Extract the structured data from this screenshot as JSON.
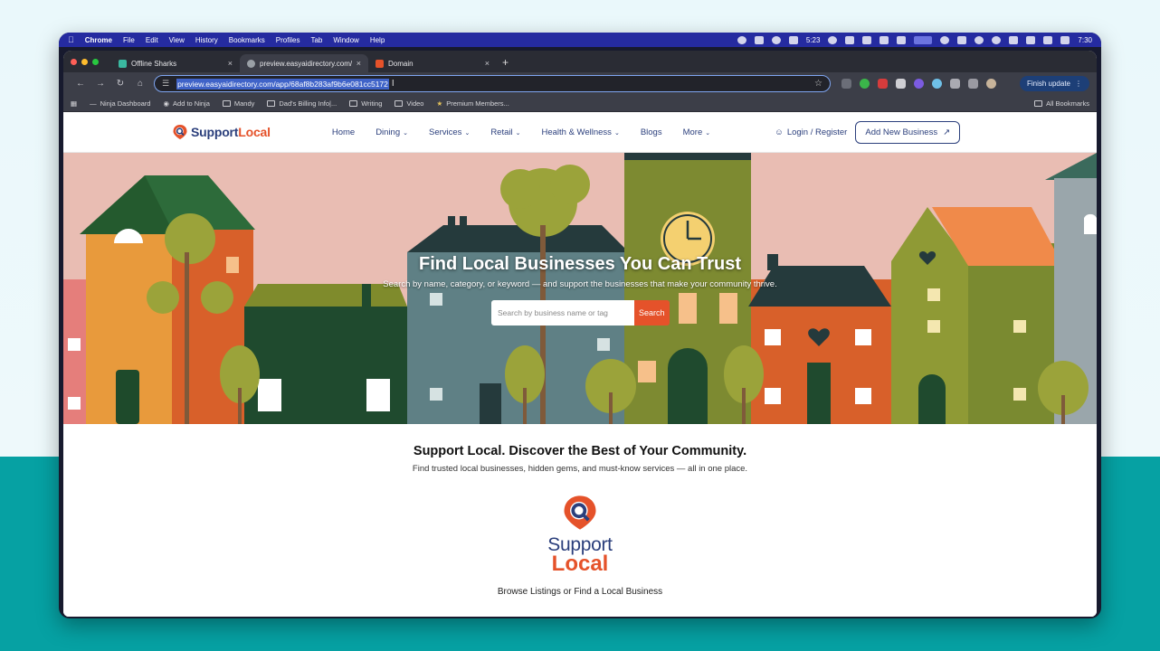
{
  "menubar": {
    "app": "Chrome",
    "items": [
      "File",
      "Edit",
      "View",
      "History",
      "Bookmarks",
      "Profiles",
      "Tab",
      "Window",
      "Help"
    ],
    "timer": "5:23",
    "clock": "7:30"
  },
  "browser": {
    "tabs": [
      {
        "title": "Offline Sharks",
        "active": false
      },
      {
        "title": "preview.easyaidirectory.com/",
        "active": true
      },
      {
        "title": "Domain",
        "active": false
      }
    ],
    "new_tab": "+",
    "close": "×",
    "url": "preview.easyaidirectory.com/app/68af8b283af9b6e081cc5172",
    "finish_update": "Finish update",
    "bookmarks": [
      "Ninja Dashboard",
      "Add to Ninja",
      "Mandy",
      "Dad's Billing Info|...",
      "Writing",
      "Video",
      "Premium Members..."
    ],
    "all_bookmarks": "All Bookmarks"
  },
  "site": {
    "brand_support": "Support",
    "brand_local": "Local",
    "nav": [
      {
        "label": "Home",
        "dropdown": false
      },
      {
        "label": "Dining",
        "dropdown": true
      },
      {
        "label": "Services",
        "dropdown": true
      },
      {
        "label": "Retail",
        "dropdown": true
      },
      {
        "label": "Health & Wellness",
        "dropdown": true
      },
      {
        "label": "Blogs",
        "dropdown": false
      },
      {
        "label": "More",
        "dropdown": true
      }
    ],
    "login": "Login / Register",
    "add_business": "Add New Business",
    "hero": {
      "title": "Find Local Businesses You Can Trust",
      "subtitle": "Search by name, category, or keyword — and support the businesses that make your community thrive.",
      "search_placeholder": "Search by business name or tag",
      "search_button": "Search"
    },
    "section": {
      "title": "Support Local. Discover the Best of Your Community.",
      "subtitle": "Find trusted local businesses, hidden gems, and must-know services — all in one place.",
      "logo_word1": "Support",
      "logo_word2": "Local",
      "browse": "Browse Listings or Find a Local Business"
    }
  },
  "colors": {
    "brand_blue": "#2b3f7c",
    "brand_orange": "#e5522a",
    "hero_bg": "#e9bdb3",
    "background_teal": "#06a1a3"
  }
}
